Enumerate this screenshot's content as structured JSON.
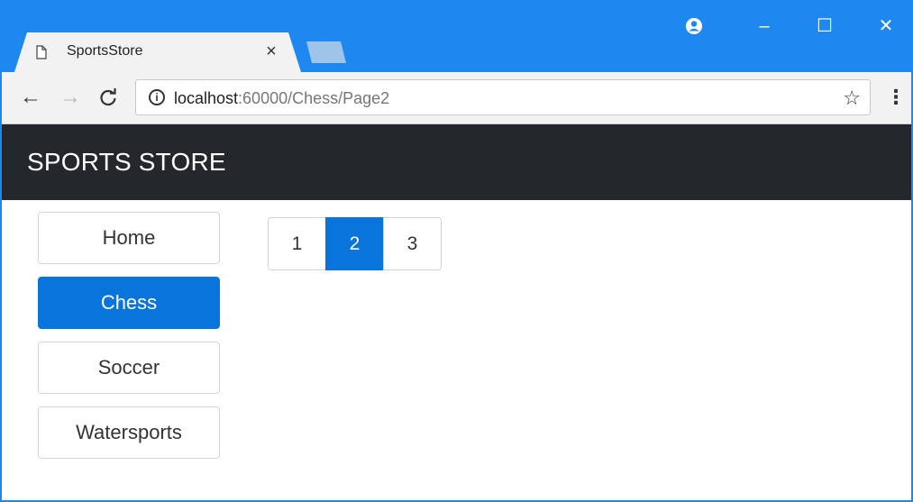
{
  "browser": {
    "tab_title": "SportsStore",
    "tab_close": "×",
    "url_host": "localhost",
    "url_path": ":60000/Chess/Page2",
    "icons": {
      "back": "←",
      "forward": "→",
      "reload": "C",
      "info": "i",
      "star": "☆",
      "menu": "⋮",
      "minimize": "–",
      "maximize": "☐",
      "close": "✕",
      "profile": "●"
    }
  },
  "navbar": {
    "brand": "SPORTS STORE"
  },
  "categories": [
    {
      "label": "Home",
      "active": false
    },
    {
      "label": "Chess",
      "active": true
    },
    {
      "label": "Soccer",
      "active": false
    },
    {
      "label": "Watersports",
      "active": false
    }
  ],
  "pagination": {
    "pages": [
      "1",
      "2",
      "3"
    ],
    "current": "2"
  },
  "colors": {
    "chrome_blue": "#1e88f0",
    "navbar_bg": "#24272b",
    "active_blue": "#0a74dd"
  }
}
